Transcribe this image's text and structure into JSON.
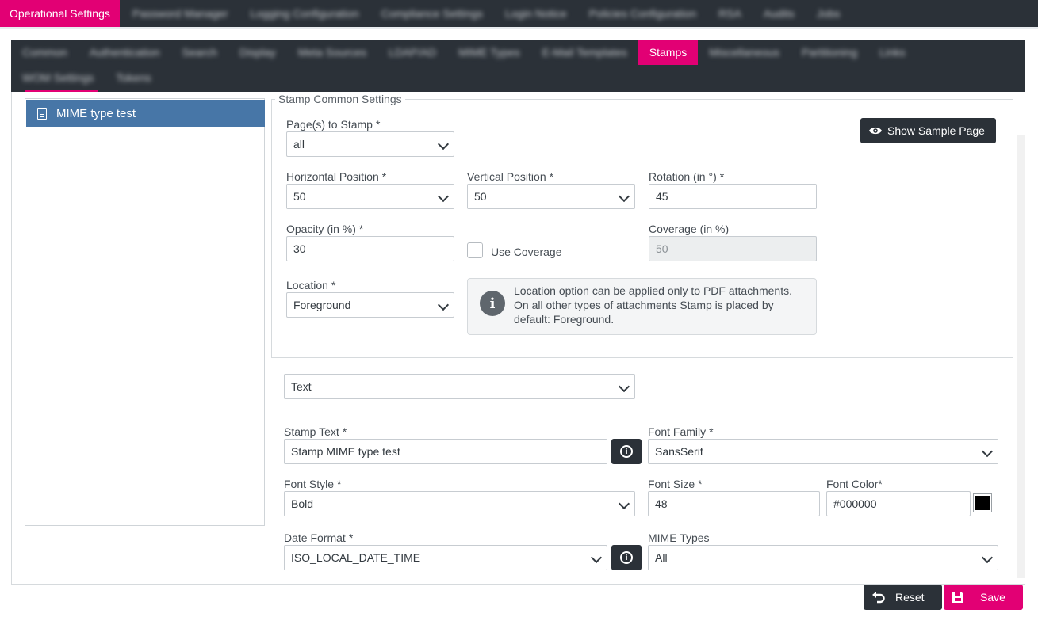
{
  "top_tabs": [
    {
      "label": "Operational Settings",
      "active": true
    },
    {
      "label": "Password Manager",
      "active": false
    },
    {
      "label": "Logging Configuration",
      "active": false
    },
    {
      "label": "Compliance Settings",
      "active": false
    },
    {
      "label": "Login Notice",
      "active": false
    },
    {
      "label": "Policies Configuration",
      "active": false
    },
    {
      "label": "RSA",
      "active": false
    },
    {
      "label": "Audits",
      "active": false
    },
    {
      "label": "Jobs",
      "active": false
    }
  ],
  "sub_tabs_row1": [
    {
      "label": "Common",
      "active": false
    },
    {
      "label": "Authentication",
      "active": false
    },
    {
      "label": "Search",
      "active": false
    },
    {
      "label": "Display",
      "active": false
    },
    {
      "label": "Meta Sources",
      "active": false
    },
    {
      "label": "LDAP/AD",
      "active": false
    },
    {
      "label": "MIME Types",
      "active": false
    },
    {
      "label": "E-Mail Templates",
      "active": false
    },
    {
      "label": "Stamps",
      "active": true
    },
    {
      "label": "Miscellaneous",
      "active": false
    },
    {
      "label": "Partitioning",
      "active": false
    },
    {
      "label": "Links",
      "active": false
    }
  ],
  "sub_tabs_row2": [
    {
      "label": "WOM Settings",
      "active": false
    },
    {
      "label": "Tokens",
      "active": false
    }
  ],
  "stamp_list": [
    {
      "label": "MIME type test",
      "selected": true
    }
  ],
  "common": {
    "legend": "Stamp Common Settings",
    "pages_label": "Page(s) to Stamp",
    "pages_value": "all",
    "hpos_label": "Horizontal Position",
    "hpos_value": "50",
    "vpos_label": "Vertical Position",
    "vpos_value": "50",
    "rotation_label": "Rotation (in °)",
    "rotation_value": "45",
    "opacity_label": "Opacity (in %)",
    "opacity_value": "30",
    "use_coverage_label": "Use Coverage",
    "use_coverage_checked": false,
    "coverage_label": "Coverage (in %)",
    "coverage_value": "50",
    "location_label": "Location",
    "location_value": "Foreground",
    "location_info": "Location option can be applied only to PDF attachments. On all other types of attachments Stamp is placed by default: Foreground.",
    "show_sample_label": "Show Sample Page",
    "required_mark": "*"
  },
  "stamp": {
    "type_value": "Text",
    "text_label": "Stamp Text",
    "text_value": "Stamp MIME type test",
    "font_family_label": "Font Family",
    "font_family_value": "SansSerif",
    "font_style_label": "Font Style",
    "font_style_value": "Bold",
    "font_size_label": "Font Size",
    "font_size_value": "48",
    "font_color_label": "Font Color",
    "font_color_value": "#000000",
    "date_format_label": "Date Format",
    "date_format_value": "ISO_LOCAL_DATE_TIME",
    "mime_types_label": "MIME Types",
    "mime_types_value": "All"
  },
  "footer": {
    "reset_label": "Reset",
    "save_label": "Save"
  },
  "colors": {
    "accent": "#e20074",
    "dark": "#2b3138",
    "selected": "#4776a7",
    "font_color_swatch": "#000000"
  },
  "icons": {
    "doc": "document-icon",
    "eye": "eye-icon",
    "info": "info-icon",
    "undo": "undo-icon",
    "save": "floppy-disk-icon"
  }
}
